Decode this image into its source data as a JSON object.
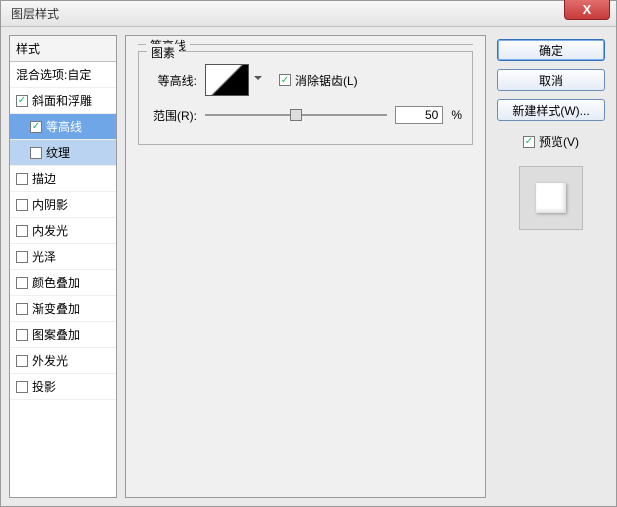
{
  "window": {
    "title": "图层样式"
  },
  "buttons": {
    "close": "X",
    "ok": "确定",
    "cancel": "取消",
    "new_style": "新建样式(W)...",
    "preview_label": "预览(V)"
  },
  "left": {
    "header": "样式",
    "items": [
      {
        "label": "混合选项:自定",
        "checked": null,
        "sub": false,
        "sel": false
      },
      {
        "label": "斜面和浮雕",
        "checked": true,
        "sub": false,
        "sel": false
      },
      {
        "label": "等高线",
        "checked": true,
        "sub": true,
        "sel": "selected"
      },
      {
        "label": "纹理",
        "checked": false,
        "sub": true,
        "sel": "selsub"
      },
      {
        "label": "描边",
        "checked": false,
        "sub": false,
        "sel": false
      },
      {
        "label": "内阴影",
        "checked": false,
        "sub": false,
        "sel": false
      },
      {
        "label": "内发光",
        "checked": false,
        "sub": false,
        "sel": false
      },
      {
        "label": "光泽",
        "checked": false,
        "sub": false,
        "sel": false
      },
      {
        "label": "颜色叠加",
        "checked": false,
        "sub": false,
        "sel": false
      },
      {
        "label": "渐变叠加",
        "checked": false,
        "sub": false,
        "sel": false
      },
      {
        "label": "图案叠加",
        "checked": false,
        "sub": false,
        "sel": false
      },
      {
        "label": "外发光",
        "checked": false,
        "sub": false,
        "sel": false
      },
      {
        "label": "投影",
        "checked": false,
        "sub": false,
        "sel": false
      }
    ]
  },
  "center": {
    "group_main": "等高线",
    "group_sub": "图素",
    "row_contour": "等高线:",
    "antialias_label": "消除锯齿(L)",
    "antialias_checked": true,
    "row_range": "范围(R):",
    "range_value": "50",
    "range_unit": "%"
  },
  "preview_checked": true
}
